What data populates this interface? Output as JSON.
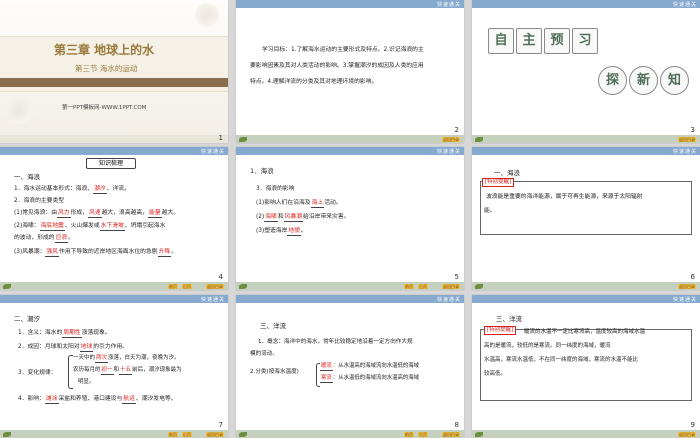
{
  "footer": {
    "leaf_label": "浴",
    "nav_prev": "前页",
    "nav_next": "后页",
    "nav_main": "返回目录",
    "top_label": "快速通关"
  },
  "slides": [
    {
      "page": "1",
      "chapter_title": "第三章  地球上的水",
      "section_title": "第三节  海水的运动",
      "footer_text": "第一PPT模板网-WWW.1PPT.COM"
    },
    {
      "page": "2",
      "lines": [
        "学习目标：1.了解海水运动的主要形式及特点。2.识记海浪的主",
        "要影响因素及其对人类活动的影响。3.掌握潮汐的成因及人类的应用",
        "特点。4.理解洋流的分类及其对地理环境的影响。"
      ]
    },
    {
      "page": "3",
      "seal_chars": [
        "自",
        "主",
        "预",
        "习"
      ],
      "circle_chars": [
        "探",
        "新",
        "知"
      ]
    },
    {
      "page": "4",
      "heading": "知识梳理",
      "h1": "一、海浪",
      "l1a": "1．海水运动基本形式：海浪、",
      "l1b": "潮汐",
      "l1c": "、洋流。",
      "l2": "2．海浪的主要类型",
      "l3a": "(1)常见海浪：由",
      "l3b": "风力",
      "l3c": "形成，",
      "l3d": "风速",
      "l3e": "越大，浪高越高，",
      "l3f": "能量",
      "l3g": "越大。",
      "l4a": "(2)海啸：",
      "l4b": "海底地震",
      "l4c": "、火山爆发或",
      "l4d": "水下滑坡",
      "l4e": "、坍塌引起海水",
      "l5a": "的波动，形成的",
      "l5b": "巨浪",
      "l5c": "。",
      "l6a": "(3)风暴潮：",
      "l6b": "强风",
      "l6c": "作用下导致的近岸地区海面水位的急剧",
      "l6d": "升降",
      "l6e": "。"
    },
    {
      "page": "5",
      "h1": "1．海浪",
      "l1": "3．海浪的影响",
      "l2a": "(1)影响人们在沿海及",
      "l2b": "海上",
      "l2c": "活动。",
      "l3a": "(2)",
      "l3b": "海啸",
      "l3c": "和",
      "l3d": "风暴潮",
      "l3e": "给沿岸带来灾害。",
      "l4a": "(3)塑造海岸",
      "l4b": "地貌",
      "l4c": "。"
    },
    {
      "page": "6",
      "h1": "一、海浪",
      "tag": "[特别提醒]",
      "lines": [
        "波浪能是重要的海洋能源，属于可再生能源，来源于太阳辐射",
        "能。"
      ]
    },
    {
      "page": "7",
      "h1": "二、潮汐",
      "l1a": "1．含义：海水的",
      "l1b": "周期性",
      "l1c": "涨落现象。",
      "l2a": "2．成因：月球和太阳对",
      "l2b": "地球",
      "l2c": "的引力作用。",
      "l3": "3．变化规律：",
      "b1a": "一天中的",
      "b1b": "两次",
      "b1c": "涨落，白天为潮，夜晚为汐。",
      "b2a": "农历每月的",
      "b2b": "初一",
      "b2c": "和",
      "b2d": "十五",
      "b2e": "前后，潮汐现象最为",
      "b3": "明显。",
      "l4a": "4．影响：",
      "l4b": "滩涂",
      "l4c": "采盐和养殖、港口建设与",
      "l4d": "航运",
      "l4e": "、潮汐发电等。"
    },
    {
      "page": "8",
      "h1": "三、洋流",
      "l1": "1．概念：海洋中的海水，常年比较稳定地沿着一定方向作大规",
      "l1b": "模的流动。",
      "l2": "2.分类(按海水温度)",
      "w1a": "暖流",
      "w1b": "：从水温高的海域流向水温低的海域",
      "w2a": "寒流",
      "w2b": "：从水温低的海域流向水温高的海域"
    },
    {
      "page": "9",
      "h1": "三、洋流",
      "tag": "[特别提醒]",
      "lines": [
        "暖流的水温不一定比寒流高，温度较高的海域水温",
        "高的是暖流，较低的是寒流。同一纬度的海域，暖流",
        "水温高，寒流水温低，不在同一纬度的海域，寒流的水温不能比",
        "较高低。"
      ],
      "lines_display": [
        "暖流的水温不一定比寒流高，温度较高的海域水温",
        "高的是暖流，较低的是寒流。同一纬度的海域，暖流",
        "水温高，寒流水温低，不在同一纬度的海域，寒流的水温不能比",
        "较高低。"
      ]
    }
  ]
}
